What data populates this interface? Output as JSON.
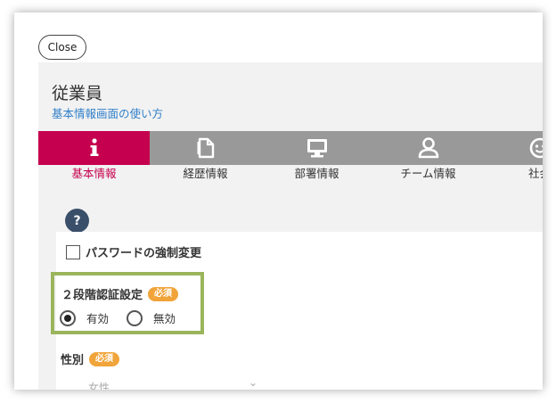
{
  "close_label": "Close",
  "page_title": "従業員",
  "help_link": "基本情報画面の使い方",
  "colors": {
    "accent": "#c5004e",
    "tab_bg": "#999999",
    "highlight": "#9bb55c",
    "required_badge": "#f0a43a",
    "link": "#2f7fc9"
  },
  "tabs": [
    {
      "label": "基本情報",
      "icon": "info-icon",
      "active": true
    },
    {
      "label": "経歴情報",
      "icon": "document-icon",
      "active": false
    },
    {
      "label": "部署情報",
      "icon": "monitor-icon",
      "active": false
    },
    {
      "label": "チーム情報",
      "icon": "person-icon",
      "active": false
    },
    {
      "label": "社会",
      "icon": "smiley-icon",
      "active": false
    }
  ],
  "help_icon": "?",
  "password_force_change": {
    "label": "パスワードの強制変更",
    "checked": false
  },
  "two_factor": {
    "label": "２段階認証設定",
    "badge": "必須",
    "options": [
      {
        "label": "有効",
        "selected": true
      },
      {
        "label": "無効",
        "selected": false
      }
    ]
  },
  "gender": {
    "label": "性別",
    "badge": "必須",
    "value": "女性"
  }
}
